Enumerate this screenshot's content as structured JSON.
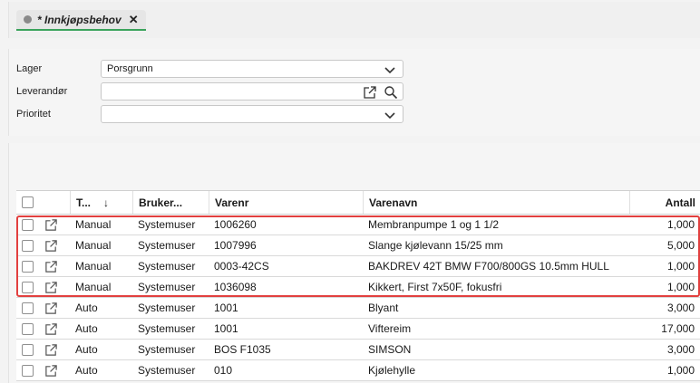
{
  "tab": {
    "title": "* Innkjøpsbehov",
    "close_glyph": "✕"
  },
  "form": {
    "lager": {
      "label": "Lager",
      "value": "Porsgrunn"
    },
    "leverandor": {
      "label": "Leverandør",
      "value": ""
    },
    "prioritet": {
      "label": "Prioritet",
      "value": ""
    }
  },
  "grid": {
    "columns": {
      "type": "T...",
      "sort_glyph": "↓",
      "user": "Bruker...",
      "varenr": "Varenr",
      "varenavn": "Varenavn",
      "antall": "Antall"
    },
    "rows": [
      {
        "type": "Manual",
        "user": "Systemuser",
        "varenr": "1006260",
        "varenavn": "Membranpumpe 1 og 1 1/2",
        "antall": "1,000",
        "highlighted": true
      },
      {
        "type": "Manual",
        "user": "Systemuser",
        "varenr": "1007996",
        "varenavn": "Slange kjølevann 15/25 mm",
        "antall": "5,000",
        "highlighted": true
      },
      {
        "type": "Manual",
        "user": "Systemuser",
        "varenr": "0003-42CS",
        "varenavn": "BAKDREV 42T BMW F700/800GS 10.5mm HULL",
        "antall": "1,000",
        "highlighted": true
      },
      {
        "type": "Manual",
        "user": "Systemuser",
        "varenr": "1036098",
        "varenavn": "Kikkert, First 7x50F, fokusfri",
        "antall": "1,000",
        "highlighted": true
      },
      {
        "type": "Auto",
        "user": "Systemuser",
        "varenr": "1001",
        "varenavn": "Blyant",
        "antall": "3,000",
        "highlighted": false
      },
      {
        "type": "Auto",
        "user": "Systemuser",
        "varenr": "1001",
        "varenavn": "Viftereim",
        "antall": "17,000",
        "highlighted": false
      },
      {
        "type": "Auto",
        "user": "Systemuser",
        "varenr": "BOS F1035",
        "varenavn": "SIMSON",
        "antall": "3,000",
        "highlighted": false
      },
      {
        "type": "Auto",
        "user": "Systemuser",
        "varenr": "010",
        "varenavn": "Kjølehylle",
        "antall": "1,000",
        "highlighted": false
      }
    ]
  },
  "colors": {
    "accent": "#3aa35b",
    "highlight": "#e2403f"
  }
}
